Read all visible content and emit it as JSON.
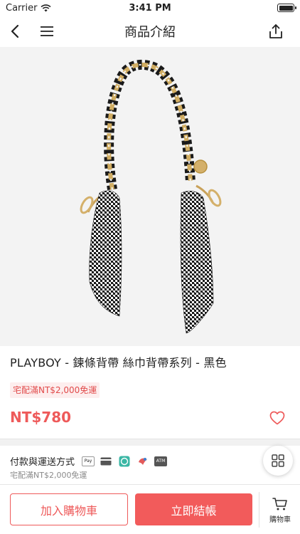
{
  "status_bar": {
    "carrier": "Carrier",
    "time": "3:41 PM",
    "battery_level": 1.0
  },
  "nav": {
    "title": "商品介紹",
    "back_icon": "chevron-left-icon",
    "menu_icon": "hamburger-menu-icon",
    "share_icon": "share-icon"
  },
  "product": {
    "image_alt": "houndstooth scarf chain strap",
    "title": "PLAYBOY - 鍊條背帶  絲巾背帶系列 - 黑色",
    "promo": "宅配滿NT$2,000免運",
    "price": "NT$780",
    "wishlist_icon": "heart-outline-icon"
  },
  "payment": {
    "label": "付款與運送方式",
    "icons": [
      "apple-pay-icon",
      "credit-card-icon",
      "line-pay-icon",
      "jko-pay-icon",
      "atm-icon"
    ],
    "apple_pay_text": "Pay",
    "atm_text": "ATM",
    "sub": "宅配滿NT$2,000免運"
  },
  "float_menu_icon": "grid-icon",
  "actions": {
    "add_to_cart": "加入購物車",
    "buy_now": "立即結帳",
    "cart_label": "購物車",
    "cart_icon": "cart-icon"
  },
  "colors": {
    "accent": "#F25B5B",
    "promo_bg": "#FDEEEE",
    "image_bg": "#F3F3F3"
  }
}
